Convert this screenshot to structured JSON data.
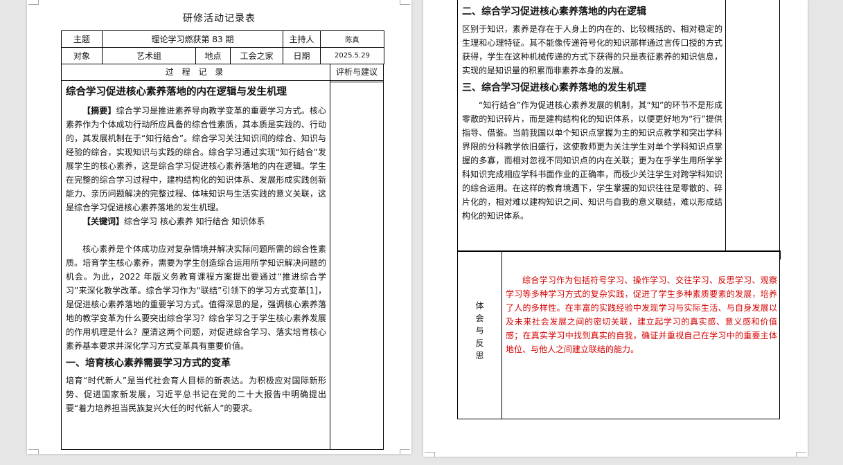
{
  "page1": {
    "form_title": "研修活动记录表",
    "info": {
      "topic_label": "主题",
      "topic_value": "理论学习燃获第 83 期",
      "host_label": "主持人",
      "host_value": "陈真",
      "audience_label": "对象",
      "audience_value": "艺术组",
      "place_label": "地点",
      "place_value": "工会之家",
      "date_label": "日期",
      "date_value": "2025.5.29"
    },
    "process_header": "过 程 记 录",
    "comment_header": "评析与建议",
    "article": {
      "title": "综合学习促进核心素养落地的内在逻辑与发生机理",
      "abstract_tag": "【摘要】",
      "abstract_text": "综合学习是推进素养导向教学变革的重要学习方式。核心素养作为个体成功行动所应具备的综合性素质，其本质是实践的、行动的，其发展机制在于“知行结合”。综合学习关注知识间的综合、知识与经验的综合，实现知识与实践的综合。综合学习通过实现“知行结合”发展学生的核心素养，这是综合学习促进核心素养落地的内在逻辑。学生在完整的综合学习过程中，建构结构化的知识体系、发展形成实践创新能力、亲历问题解决的完整过程、体味知识与生活实践的意义关联，这是综合学习促进核心素养落地的发生机理。",
      "keywords_tag": "【关键词】",
      "keywords_text": "综合学习  核心素养  知行结合  知识体系",
      "body_para": "核心素养是个体成功应对复杂情境并解决实际问题所需的综合性素质。培育学生核心素养，需要为学生创造综合运用所学知识解决问题的机会。为此，2022 年版义务教育课程方案提出要通过“推进综合学习”来深化教学改革。综合学习作为“联结”引领下的学习方式变革[1]，是促进核心素养落地的重要学习方式。值得深思的是，强调核心素养落地的教学变革为什么要突出综合学习？综合学习之于学生核心素养发展的作用机理是什么？厘清这两个问题，对促进综合学习、落实培育核心素养基本要求并深化学习方式变革具有重要价值。",
      "section1_title": "一、培育核心素养需要学习方式的变革",
      "section1_para": "培育“时代新人”是当代社会育人目标的新表达。为积极应对国际新形势、促进国家新发展，习近平总书记在党的二十大报告中明确提出要“着力培养担当民族复兴大任的时代新人”的要求。"
    }
  },
  "page2": {
    "section2_title": "二、综合学习促进核心素养落地的内在逻辑",
    "section2_para": "区别于知识，素养是存在于人身上的内在的、比较概括的、相对稳定的生理和心理特征。其不能像传递符号化的知识那样通过言传口授的方式获得，学生在这种机械传递的方式下获得的只是表征素养的知识信息，实现的是知识量的积累而非素养本身的发展。",
    "section3_title": "三、综合学习促进核心素养落地的发生机理",
    "section3_para": "“知行结合”作为促进核心素养发展的机制，其“知”的环节不是形成零散的知识碎片，而是建构结构化的知识体系，以便更好地为“行”提供指导、借鉴。当前我国以单个知识点掌握为主的知识点教学和突出学科界限的分科教学依旧盛行，这使教师更为关注学生对单个学科知识点掌握的多寡，而相对忽视不同知识点的内在关联；更为在乎学生用所学学科知识完成相应学科书面作业的正确率，而极少关注学生对跨学科知识的综合运用。在这样的教育境遇下，学生掌握的知识往往是零散的、碎片化的，相对难以建构知识之间、知识与自我的意义联结，难以形成结构化的知识体系。",
    "reflection_label": [
      "体",
      "会",
      "与",
      "反",
      "思"
    ],
    "reflection_text": "综合学习作为包括符号学习、操作学习、交往学习、反思学习、观察学习等多种学习方式的复杂实践，促进了学生多种素质要素的发展，培养了人的多样性。在丰富的实践经验中发现学习与实际生活、与自身发展以及未来社会发展之间的密切关联，建立起学习的真实感、意义感和价值感；在真实学习中找到真实的自我，确证并重视自己在学习中的重要主体地位、与他人之间建立联结的能力。",
    "reflection_color": "#d40000"
  }
}
